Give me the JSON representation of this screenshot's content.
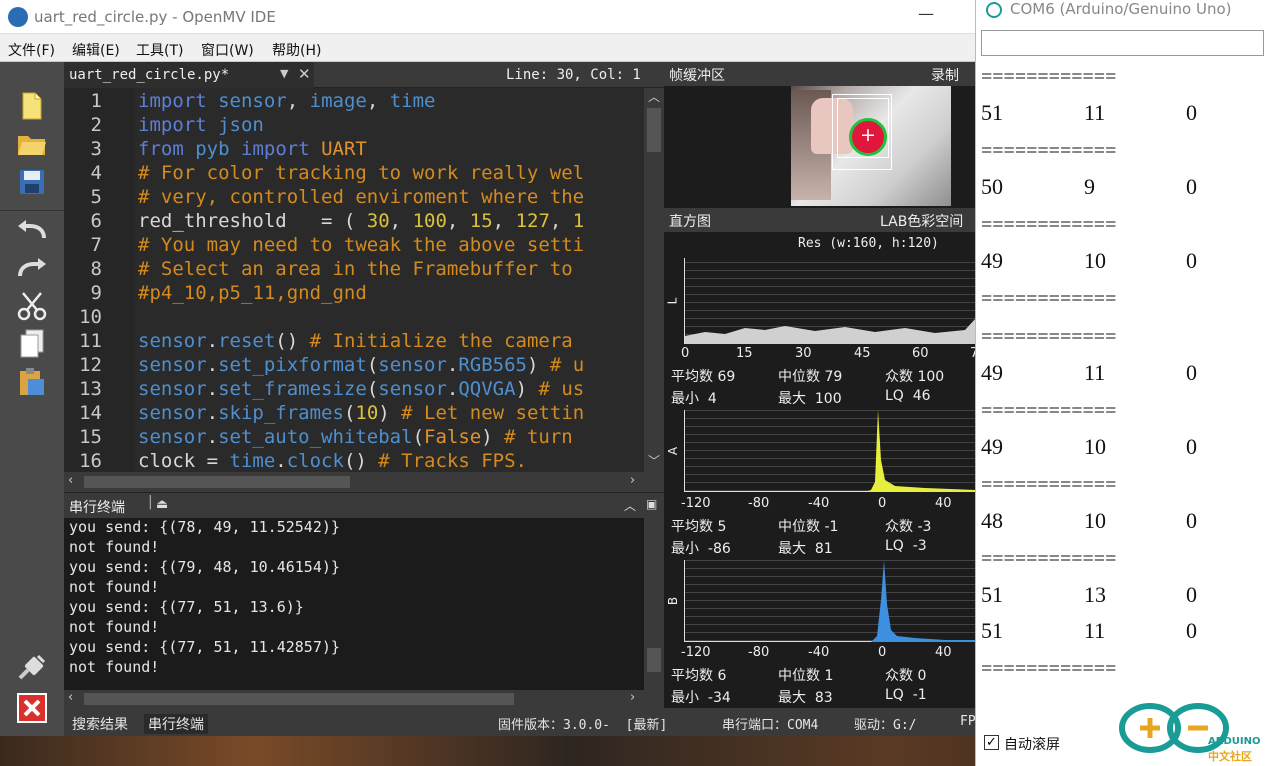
{
  "window": {
    "title": "uart_red_circle.py - OpenMV IDE",
    "minimize_glyph": "—"
  },
  "menu": [
    "文件(F)",
    "编辑(E)",
    "工具(T)",
    "窗口(W)",
    "帮助(H)"
  ],
  "editor": {
    "tab_label": "uart_red_circle.py*",
    "cursor_info": "Line: 30, Col: 1",
    "line_numbers": [
      "1",
      "2",
      "3",
      "4",
      "5",
      "6",
      "7",
      "8",
      "9",
      "10",
      "11",
      "12",
      "13",
      "14",
      "15",
      "16"
    ]
  },
  "terminal": {
    "title": "串行终端",
    "lines": [
      "you send: {(78, 49, 11.52542)}",
      "not found!",
      "you send: {(79, 48, 10.46154)}",
      "not found!",
      "you send: {(77, 51, 13.6)}",
      "not found!",
      "you send: {(77, 51, 11.42857)}",
      "not found!"
    ]
  },
  "framebuffer": {
    "title": "帧缓冲区",
    "record_label": "录制"
  },
  "histogram": {
    "title": "直方图",
    "colorspace": "LAB色彩空间",
    "res": "Res (w:160, h:120)",
    "L": {
      "axis": "L",
      "ticks": [
        "0",
        "15",
        "30",
        "45",
        "60",
        "7"
      ],
      "stats": [
        "平均数 69",
        "中位数 79",
        "众数 100",
        "最小  4",
        "最大  100",
        "LQ  46"
      ]
    },
    "A": {
      "axis": "A",
      "ticks": [
        "-120",
        "-80",
        "-40",
        "0",
        "40"
      ],
      "stats": [
        "平均数 5",
        "中位数 -1",
        "众数 -3",
        "最小  -86",
        "最大  81",
        "LQ  -3"
      ]
    },
    "B": {
      "axis": "B",
      "ticks": [
        "-120",
        "-80",
        "-40",
        "0",
        "40"
      ],
      "stats": [
        "平均数 6",
        "中位数 1",
        "众数 0",
        "最小  -34",
        "最大  83",
        "LQ  -1"
      ]
    }
  },
  "status": {
    "tab_search": "搜索结果",
    "tab_serial": "串行终端",
    "firmware": "固件版本：3.0.0-  [最新]",
    "port": "串行端口：COM4",
    "drive": "驱动：G:/",
    "fps": "FP"
  },
  "serial_monitor": {
    "title": "COM6 (Arduino/Genuino Uno)",
    "lines": [
      {
        "kind": "sep",
        "text": "============"
      },
      {
        "kind": "row",
        "a": "51",
        "b": "11",
        "c": "0"
      },
      {
        "kind": "sep",
        "text": "============"
      },
      {
        "kind": "row",
        "a": "50",
        "b": "9",
        "c": "0"
      },
      {
        "kind": "sep",
        "text": "============"
      },
      {
        "kind": "row",
        "a": "49",
        "b": "10",
        "c": "0"
      },
      {
        "kind": "sep",
        "text": "============"
      },
      {
        "kind": "sep",
        "text": "============"
      },
      {
        "kind": "row",
        "a": "49",
        "b": "11",
        "c": "0"
      },
      {
        "kind": "sep",
        "text": "============"
      },
      {
        "kind": "row",
        "a": "49",
        "b": "10",
        "c": "0"
      },
      {
        "kind": "sep",
        "text": "============"
      },
      {
        "kind": "row",
        "a": "48",
        "b": "10",
        "c": "0"
      },
      {
        "kind": "sep",
        "text": "============"
      },
      {
        "kind": "row",
        "a": "51",
        "b": "13",
        "c": "0"
      },
      {
        "kind": "row",
        "a": "51",
        "b": "11",
        "c": "0"
      },
      {
        "kind": "sep",
        "text": "============"
      }
    ],
    "autoscroll_label": "自动滚屏",
    "logo_text": "ARDUINO",
    "logo_sub": "中文社区"
  },
  "colors": {
    "accent_green": "#8be000",
    "hist_blue": "#3d8fe0",
    "hist_yellow": "#e6f03c",
    "hist_gray": "#d0d0d0"
  }
}
